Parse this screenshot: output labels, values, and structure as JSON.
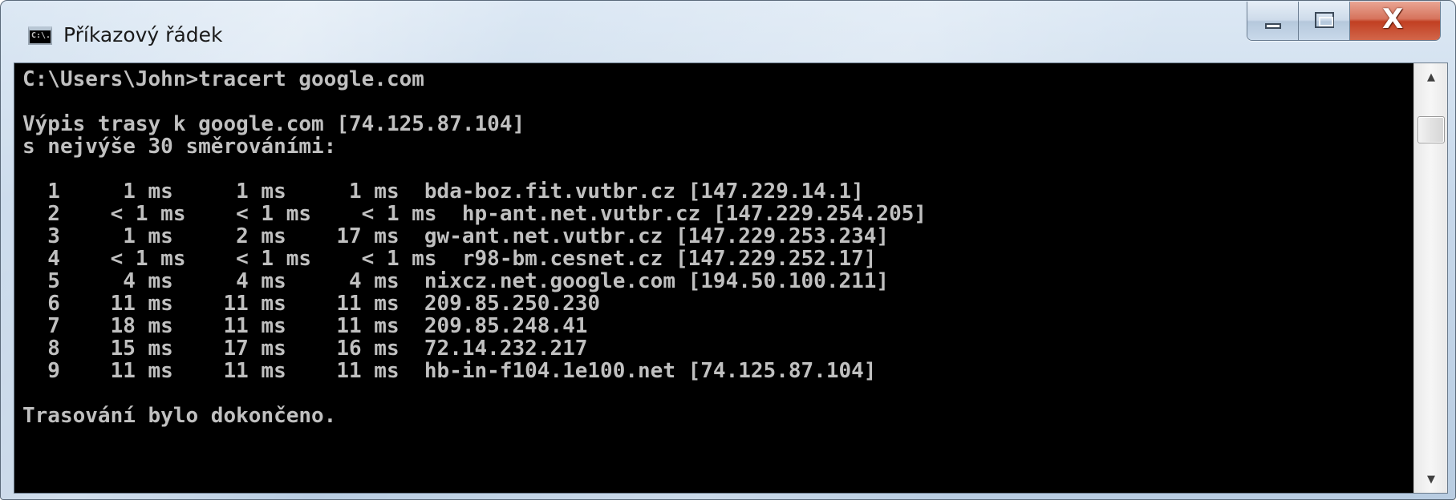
{
  "window": {
    "title": "Příkazový řádek",
    "icon_label": "C:\\.",
    "icon": "console-icon",
    "buttons": {
      "minimize": "minimize-icon",
      "maximize": "maximize-icon",
      "close": "close-icon",
      "close_glyph": "X"
    }
  },
  "console": {
    "lines": [
      "C:\\Users\\John>tracert google.com",
      "",
      "Výpis trasy k google.com [74.125.87.104]",
      "s nejvýše 30 směrováními:",
      "",
      "  1     1 ms     1 ms     1 ms  bda-boz.fit.vutbr.cz [147.229.14.1]",
      "  2    < 1 ms    < 1 ms    < 1 ms  hp-ant.net.vutbr.cz [147.229.254.205]",
      "  3     1 ms     2 ms    17 ms  gw-ant.net.vutbr.cz [147.229.253.234]",
      "  4    < 1 ms    < 1 ms    < 1 ms  r98-bm.cesnet.cz [147.229.252.17]",
      "  5     4 ms     4 ms     4 ms  nixcz.net.google.com [194.50.100.211]",
      "  6    11 ms    11 ms    11 ms  209.85.250.230",
      "  7    18 ms    11 ms    11 ms  209.85.248.41",
      "  8    15 ms    17 ms    16 ms  72.14.232.217",
      "  9    11 ms    11 ms    11 ms  hb-in-f104.1e100.net [74.125.87.104]",
      "",
      "Trasování bylo dokončeno."
    ]
  },
  "scrollbar": {
    "up_arrow": "▲",
    "down_arrow": "▼"
  },
  "colors": {
    "console_bg": "#000000",
    "console_fg": "#c0c0c0",
    "close_button": "#c13f22"
  }
}
